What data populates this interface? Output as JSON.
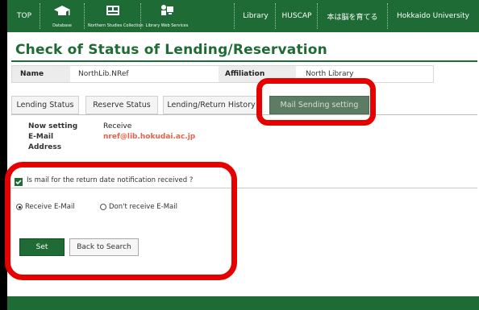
{
  "nav": {
    "top_label": "TOP",
    "db_label": "Database",
    "nsc_label": "Northern Studies Collection",
    "lws_label": "Library Web Services",
    "right_items": [
      "Library",
      "HUSCAP",
      "本は脳を育てる",
      "Hokkaido University"
    ]
  },
  "page": {
    "title": "Check of Status of Lending/Reservation"
  },
  "info": {
    "name_label": "Name",
    "name_value": "NorthLib.NRef",
    "affiliation_label": "Affiliation",
    "affiliation_value": "North Library"
  },
  "tabs": [
    {
      "label": "Lending Status"
    },
    {
      "label": "Reserve Status"
    },
    {
      "label": "Lending/Return History"
    },
    {
      "label": "Mail Sending setting"
    }
  ],
  "settings": {
    "now_setting_label": "Now setting",
    "now_setting_value": "Receive",
    "email_label_1": "E-Mail",
    "email_label_2": "Address",
    "email_value": "nref@lib.hokudai.ac.jp"
  },
  "question": {
    "text": "Is mail for the return date notification received ?"
  },
  "options": {
    "receive": "Receive E-Mail",
    "dont_receive": "Don't receive E-Mail",
    "selected": "receive"
  },
  "buttons": {
    "set": "Set",
    "back": "Back to Search"
  },
  "colors": {
    "brand_green": "#1f6b35",
    "active_tab": "#5c7c63",
    "email_text": "#e8624a",
    "callout_red": "#e60000"
  }
}
